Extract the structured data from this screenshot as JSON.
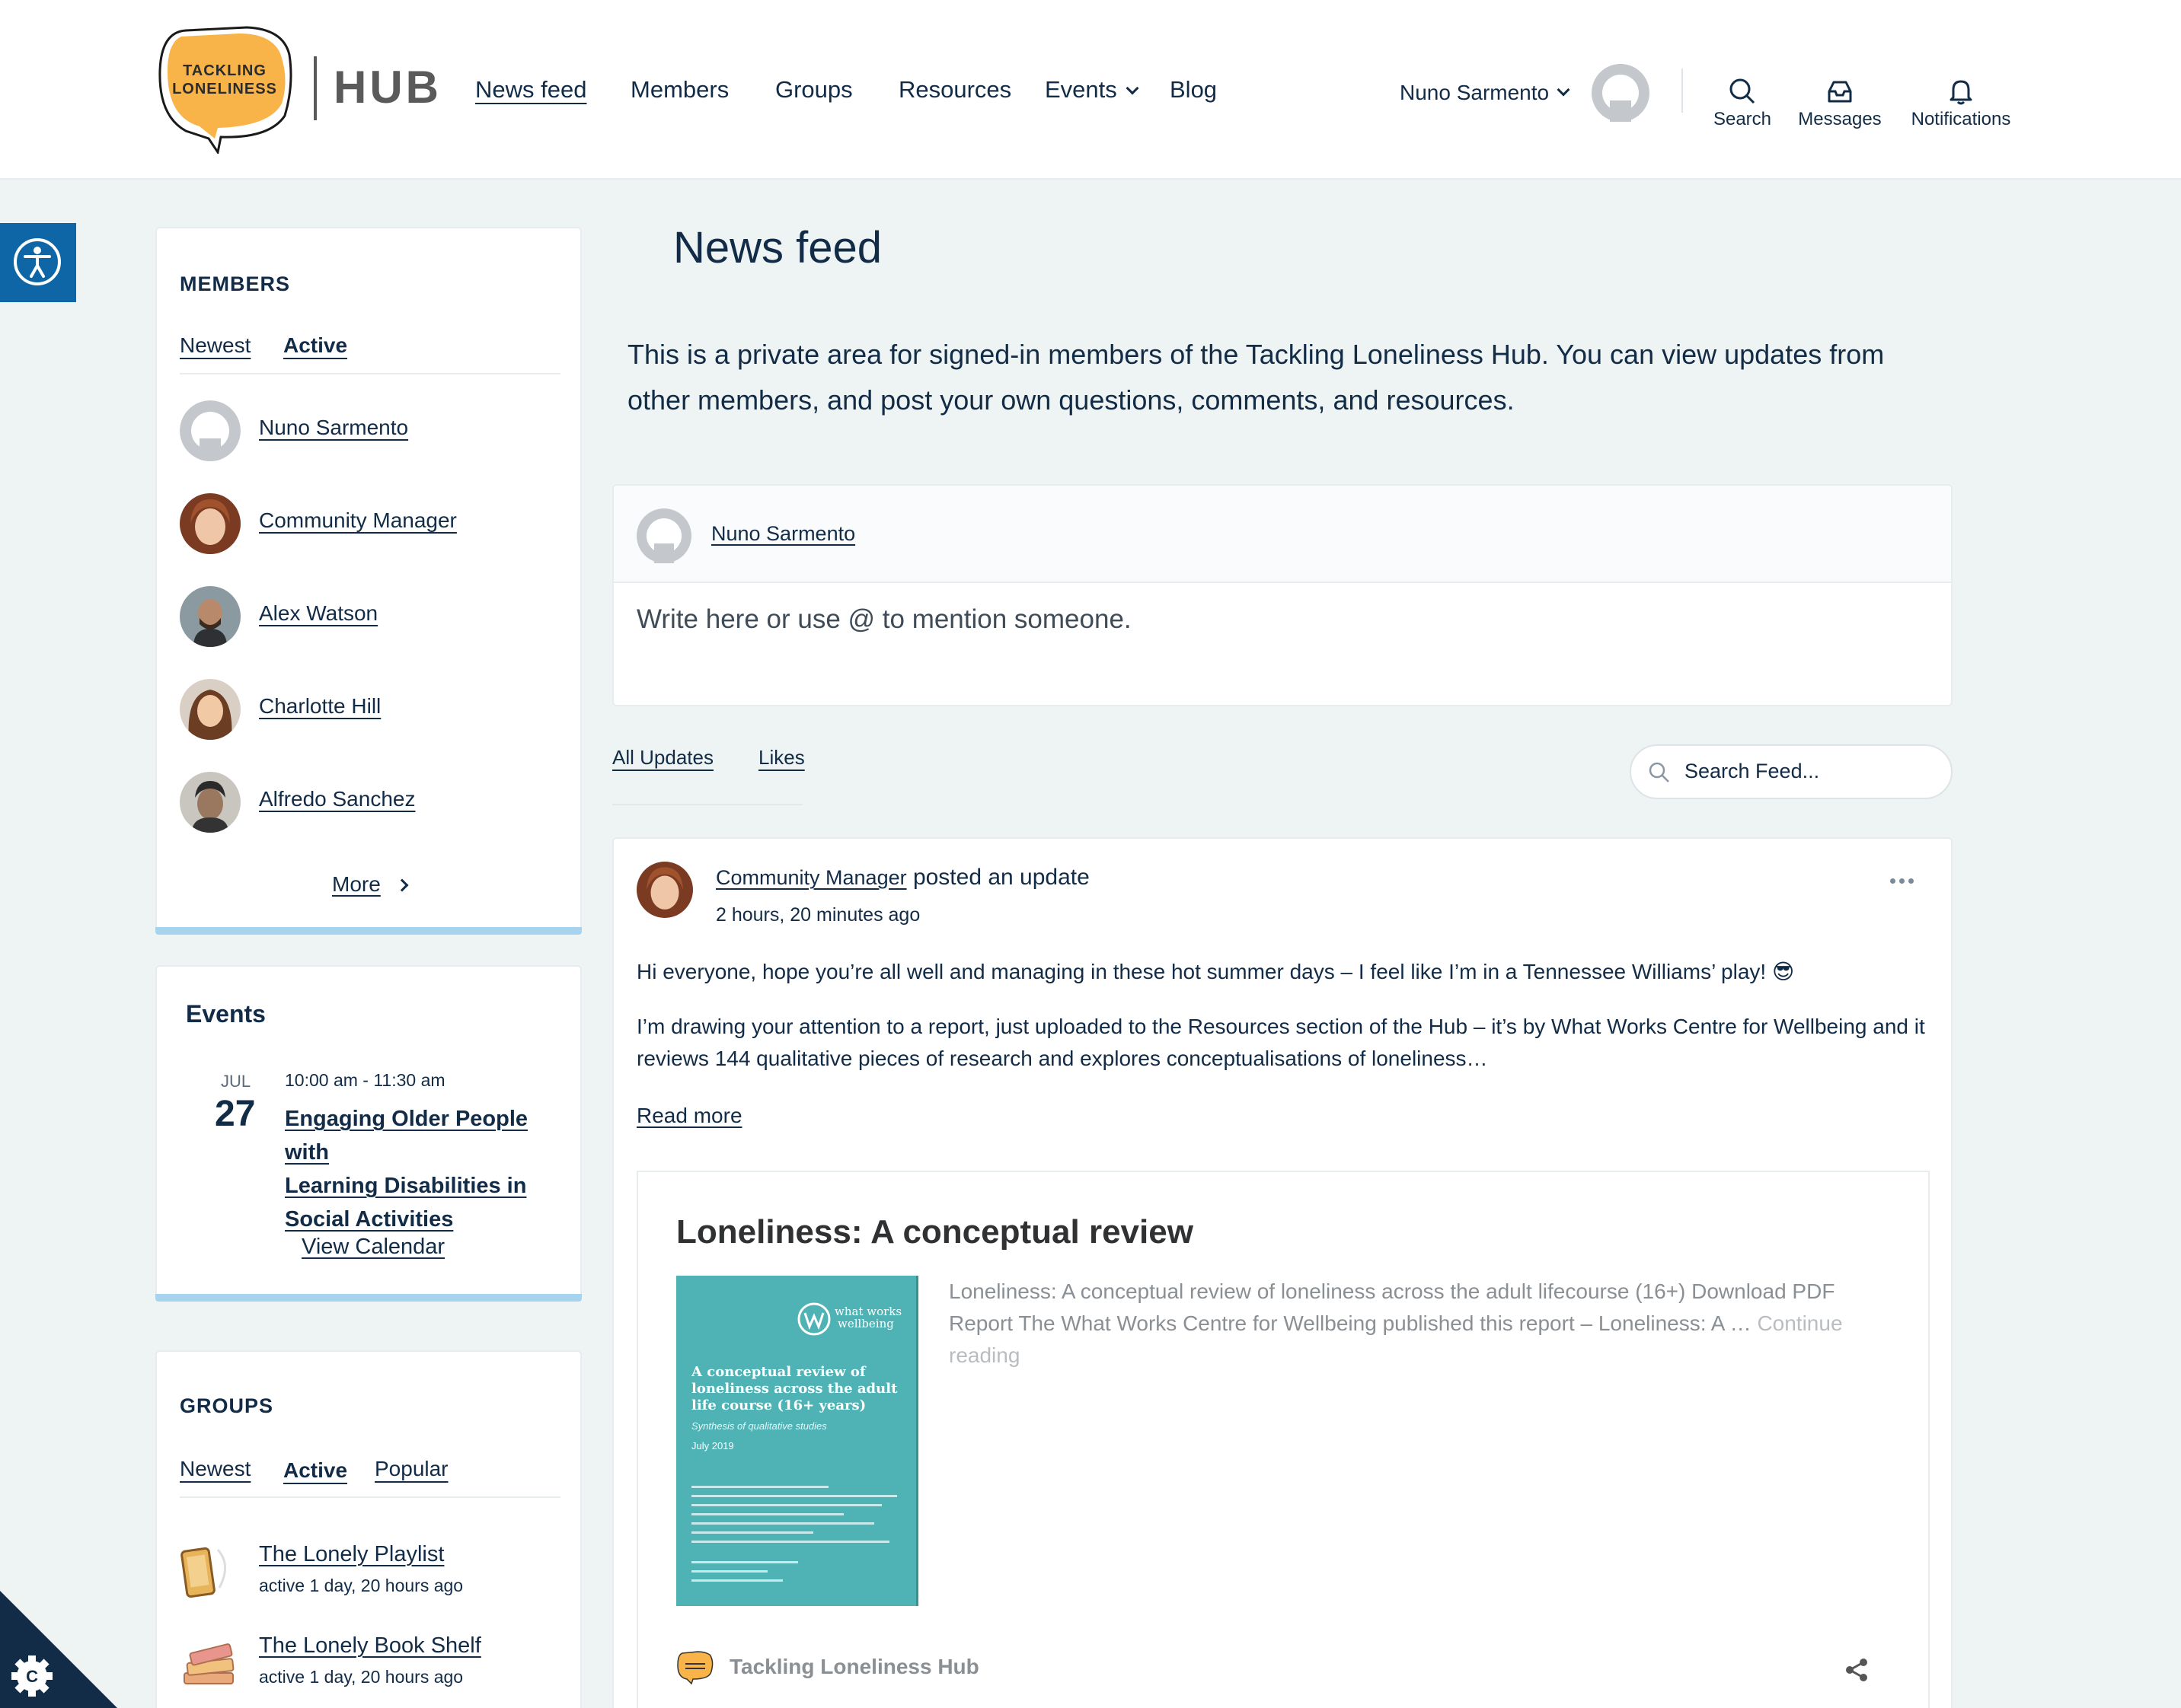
{
  "header": {
    "logo_line1": "TACKLING",
    "logo_line2": "LONELINESS",
    "logo_hub": "HUB",
    "nav": [
      "News feed",
      "Members",
      "Groups",
      "Resources",
      "Events",
      "Blog"
    ],
    "user_name": "Nuno Sarmento",
    "tools": {
      "search": "Search",
      "messages": "Messages",
      "notifications": "Notifications"
    }
  },
  "sidebar": {
    "members": {
      "title": "MEMBERS",
      "tabs": [
        "Newest",
        "Active"
      ],
      "active_tab": "Active",
      "list": [
        "Nuno Sarmento",
        "Community Manager",
        "Alex Watson",
        "Charlotte Hill",
        "Alfredo Sanchez"
      ],
      "more": "More"
    },
    "events": {
      "title": "Events",
      "month": "JUL",
      "day": "27",
      "time": "10:00 am - 11:30 am",
      "event_title_lines": [
        "Engaging Older People with",
        "Learning Disabilities in",
        "Social Activities"
      ],
      "view_calendar": "View Calendar"
    },
    "groups": {
      "title": "GROUPS",
      "tabs": [
        "Newest",
        "Active",
        "Popular"
      ],
      "active_tab": "Active",
      "list": [
        {
          "name": "The Lonely Playlist",
          "meta": "active 1 day, 20 hours ago"
        },
        {
          "name": "The Lonely Book Shelf",
          "meta": "active 1 day, 20 hours ago"
        }
      ]
    }
  },
  "main": {
    "title": "News feed",
    "intro": "This is a private area for signed-in members of the Tackling Loneliness Hub. You can view updates from other members, and post your own questions, comments, and resources.",
    "composer": {
      "user": "Nuno Sarmento",
      "placeholder": "Write here or use @ to mention someone."
    },
    "feed_tabs": [
      "All Updates",
      "Likes"
    ],
    "search_placeholder": "Search Feed...",
    "post": {
      "author": "Community Manager",
      "action": "posted an update",
      "time": "2 hours, 20 minutes ago",
      "para1": "Hi everyone, hope you’re all well and managing in these hot summer days – I feel like I’m in a Tennessee Williams’ play! 😎",
      "para2_line1": "I’m drawing your attention to a report, just uploaded to the Resources section of the Hub – it’s by What Works Centre for Wellbeing and it",
      "para2_line2": "reviews 144 qualitative pieces of research and explores conceptualisations of loneliness…",
      "read_more": "Read more",
      "link": {
        "title": "Loneliness: A conceptual review",
        "excerpt_line1": "Loneliness: A conceptual review of loneliness across the adult lifecourse (16+) Download PDF",
        "excerpt_line2": "Report The What Works Centre for Wellbeing published this report – Loneliness: A … ",
        "continue": "Continue",
        "reading": "reading",
        "site": "Tackling Loneliness Hub",
        "cover": {
          "brand1": "what works",
          "brand2": "wellbeing",
          "heading_lines": [
            "A conceptual review of",
            "loneliness across the adult",
            "life course (16+ years)"
          ],
          "sub": "Synthesis of qualitative studies",
          "date": "July 2019"
        }
      }
    }
  },
  "colors": {
    "brand_orange": "#f8b449",
    "navy": "#122b46",
    "teal": "#4fb3b5",
    "accent_blue": "#0e66a6",
    "bar_blue": "#a6d4ef"
  }
}
